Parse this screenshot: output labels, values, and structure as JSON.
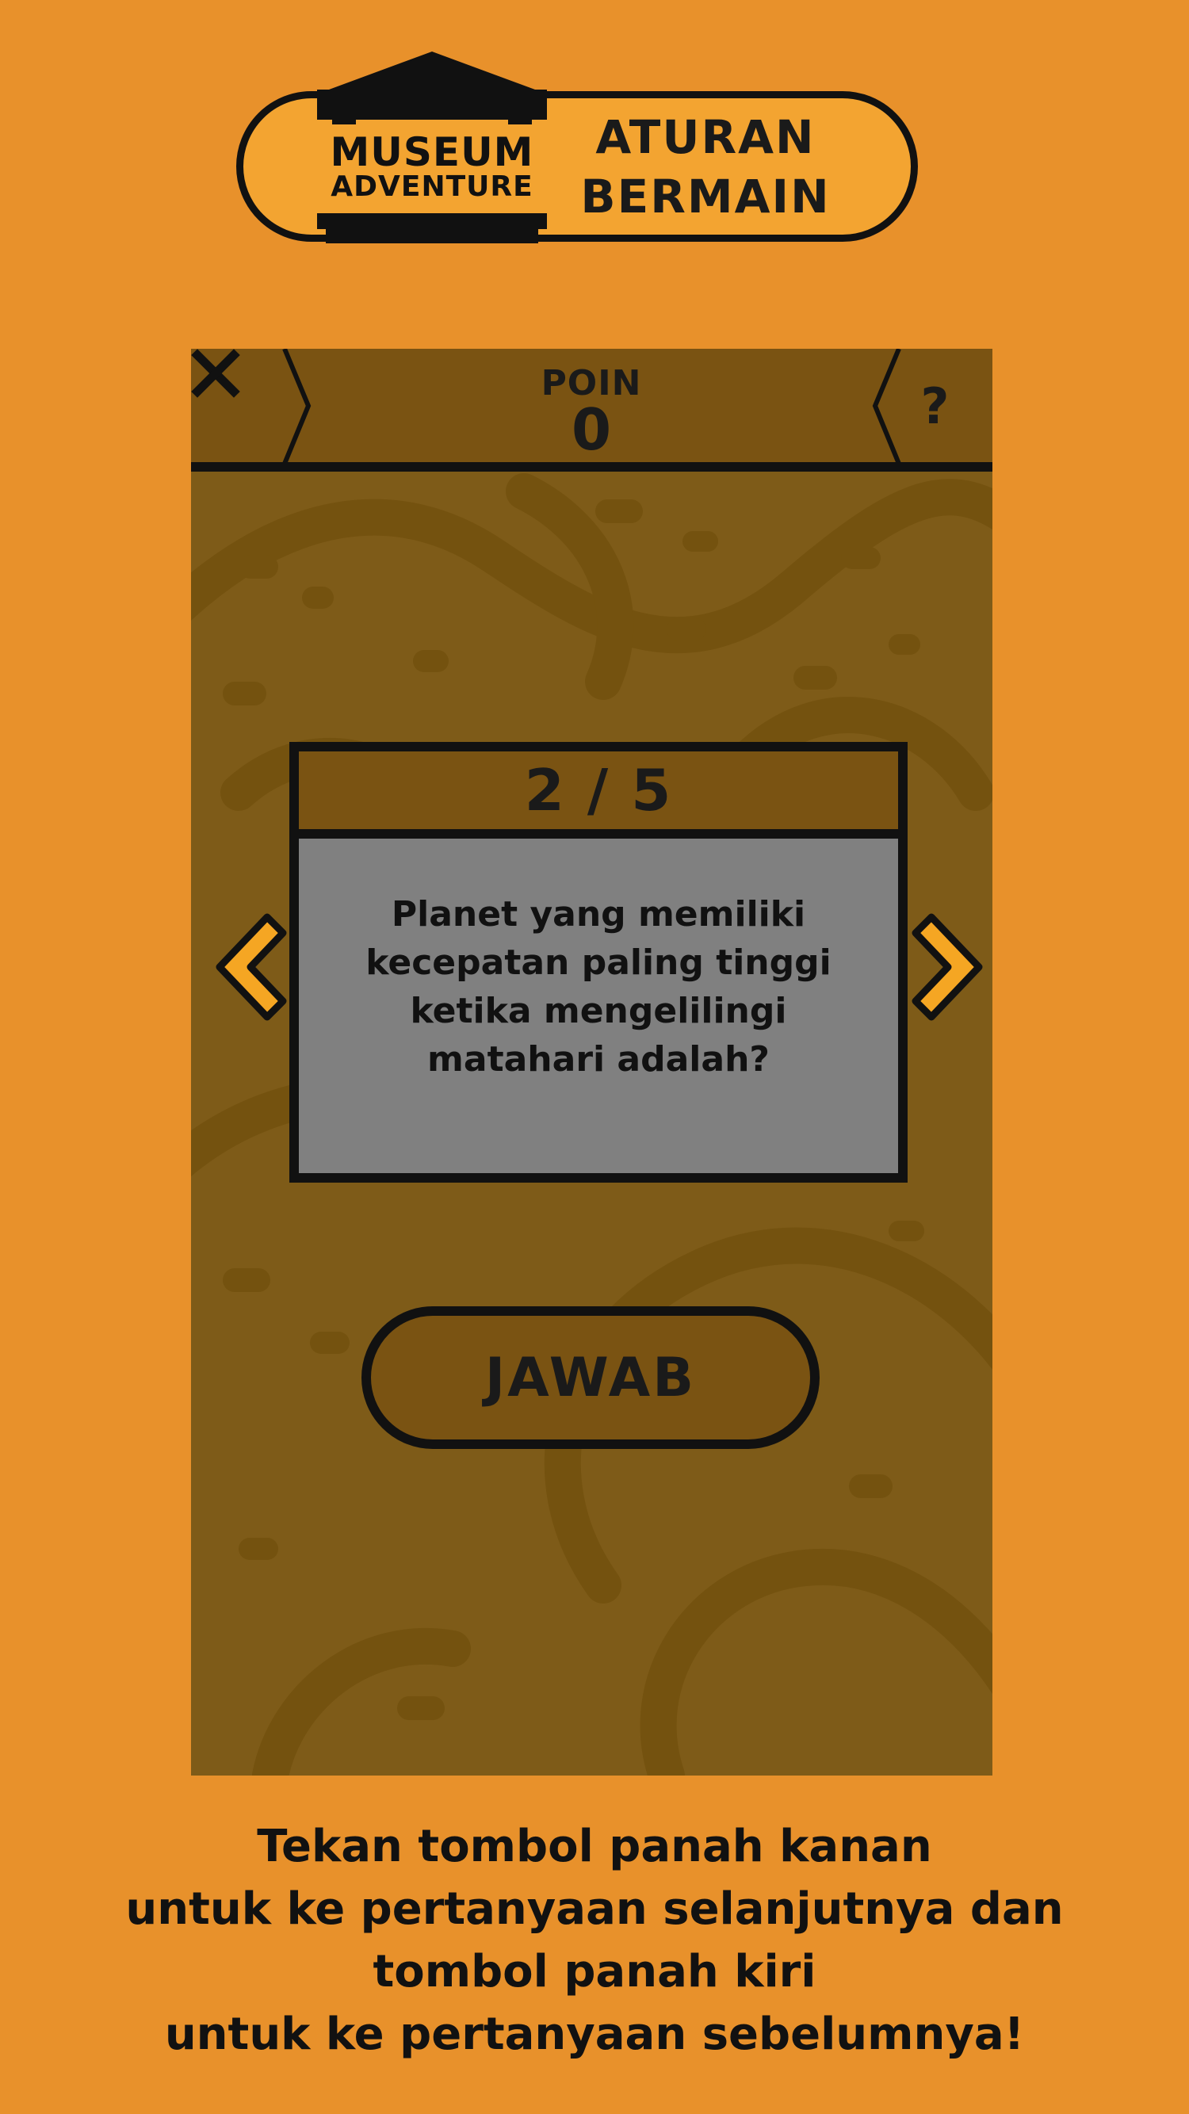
{
  "header": {
    "logo_line1": "MUSEUM",
    "logo_line2": "ADVENTURE",
    "title_line1": "ATURAN",
    "title_line2": "BERMAIN"
  },
  "game": {
    "close_icon": "close-icon",
    "help_label": "?",
    "poin_label": "POIN",
    "poin_value": "0",
    "counter": "2 / 5",
    "question_lines": [
      "Planet yang memiliki",
      "kecepatan paling tinggi",
      "ketika mengelilingi",
      "matahari adalah?"
    ],
    "prev_icon": "chevron-left-icon",
    "next_icon": "chevron-right-icon",
    "answer_label": "JAWAB"
  },
  "instruction": {
    "lines": [
      "Tekan tombol panah kanan",
      "untuk ke pertanyaan selanjutnya dan",
      "tombol panah kiri",
      "untuk ke pertanyaan sebelumnya!"
    ]
  },
  "colors": {
    "page_background": "#E8912B",
    "banner_fill": "#F3A431",
    "phone_background": "#7E5B18",
    "panel_brown": "#7A5312",
    "card_gray": "#808080",
    "arrow_fill": "#F5A623",
    "ink": "#111111"
  }
}
